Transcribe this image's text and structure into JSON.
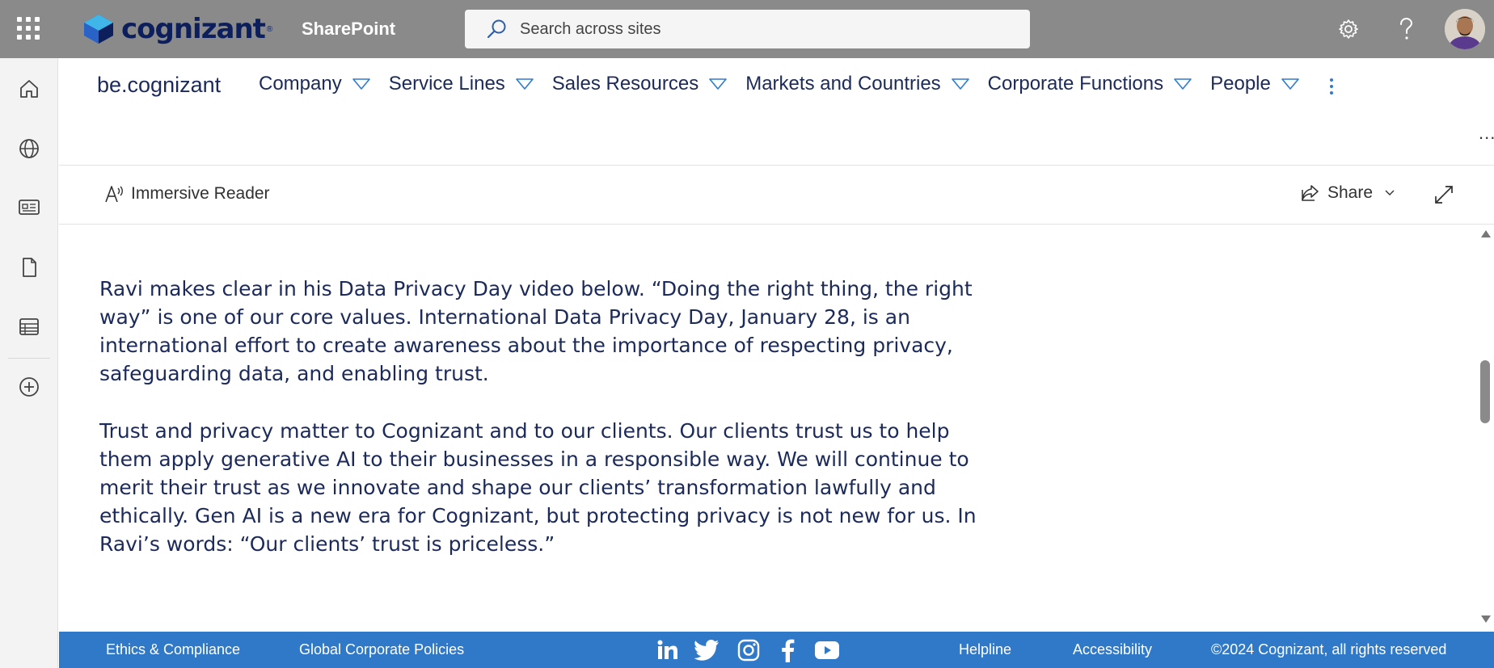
{
  "suitebar": {
    "app_name": "SharePoint",
    "logo_text": "cognizant",
    "logo_tm": "®",
    "search_placeholder": "Search across sites"
  },
  "site": {
    "name": "be.cognizant",
    "nav": [
      {
        "label": "Company"
      },
      {
        "label": "Service Lines"
      },
      {
        "label": "Sales Resources"
      },
      {
        "label": "Markets and Countries"
      },
      {
        "label": "Corporate Functions"
      },
      {
        "label": "People"
      }
    ],
    "more_label": "..."
  },
  "commandbar": {
    "immersive_reader": "Immersive Reader",
    "share": "Share"
  },
  "article": {
    "paragraphs": [
      "Ravi makes clear in his Data Privacy Day video below.  “Doing the right thing, the right way” is one of our core values. International Data Privacy Day, January 28, is an international effort to create awareness about the importance of respecting privacy, safeguarding data, and enabling trust.",
      "Trust and privacy matter to Cognizant and to our clients. Our clients trust us to help them apply generative AI to their businesses in a responsible way. We will continue to merit their trust as we innovate and shape our clients’ transformation lawfully and ethically. Gen AI is a new era for Cognizant, but protecting privacy is not new for us.  In Ravi’s words: “Our clients’ trust is priceless.”"
    ]
  },
  "footer": {
    "ethics": "Ethics & Compliance",
    "policies": "Global Corporate Policies",
    "helpline": "Helpline",
    "accessibility": "Accessibility",
    "copyright": "©2024 Cognizant, all rights reserved",
    "social": [
      "linkedin-icon",
      "twitter-icon",
      "instagram-icon",
      "facebook-icon",
      "youtube-icon"
    ]
  },
  "colors": {
    "suitebar": "#8a8a8a",
    "text_navy": "#1c2a5a",
    "footer": "#2f79c8",
    "accent": "#2f7bd0"
  }
}
